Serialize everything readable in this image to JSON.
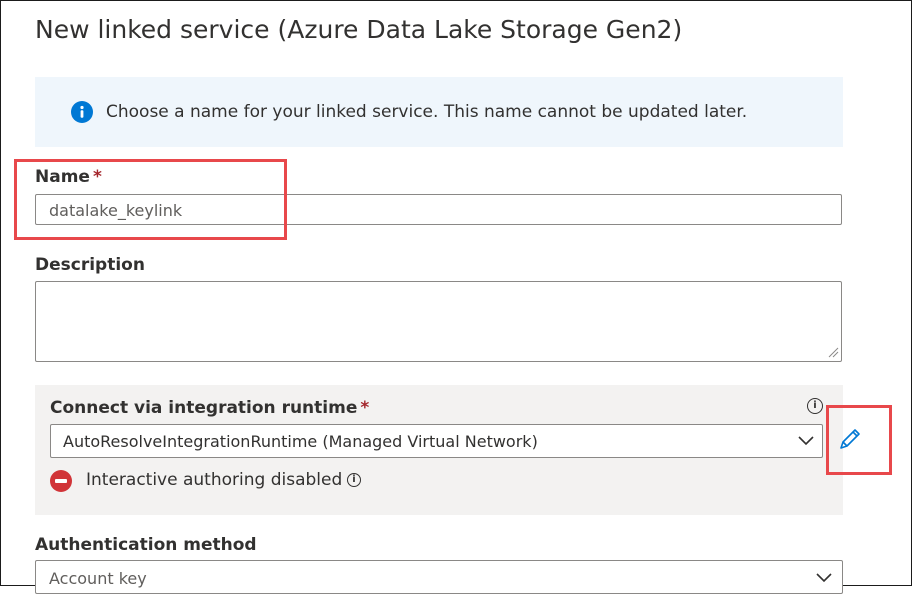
{
  "panel": {
    "title": "New linked service (Azure Data Lake Storage Gen2)"
  },
  "info_bar": {
    "icon": "info-icon",
    "text": "Choose a name for your linked service. This name cannot be updated later."
  },
  "name_field": {
    "label": "Name",
    "required_marker": "*",
    "value": "datalake_keylink"
  },
  "description_field": {
    "label": "Description",
    "value": ""
  },
  "integration_runtime": {
    "label": "Connect via integration runtime",
    "required_marker": "*",
    "selected": "AutoResolveIntegrationRuntime (Managed Virtual Network)",
    "info_icon": "info-icon",
    "edit_icon": "pencil-icon",
    "status_icon": "blocked-icon",
    "status_text": "Interactive authoring disabled"
  },
  "authentication": {
    "label": "Authentication method",
    "selected": "Account key"
  },
  "colors": {
    "accent": "#0078d4",
    "required": "#a4262c",
    "error": "#d13438",
    "callout": "#e8484b",
    "info_bg": "#eff6fc",
    "panel_bg": "#f3f2f1"
  }
}
